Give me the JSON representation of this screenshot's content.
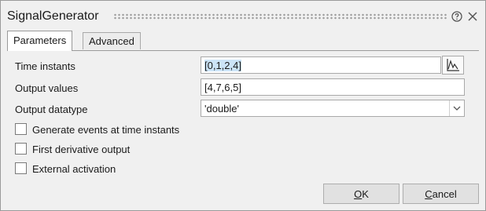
{
  "window": {
    "title": "SignalGenerator",
    "help_icon": "help-circle-icon",
    "close_icon": "close-icon"
  },
  "tabs": [
    {
      "label": "Parameters",
      "active": true
    },
    {
      "label": "Advanced",
      "active": false
    }
  ],
  "parameters": {
    "time_instants": {
      "label": "Time instants",
      "value": "[0,1,2,4]",
      "plot_icon": "plot-icon"
    },
    "output_values": {
      "label": "Output values",
      "value": "[4,7,6,5]"
    },
    "output_datatype": {
      "label": "Output datatype",
      "value": "'double'",
      "arrow_icon": "chevron-down-icon"
    }
  },
  "checkboxes": [
    {
      "label": "Generate events at time instants",
      "checked": false
    },
    {
      "label": "First derivative output",
      "checked": false
    },
    {
      "label": "External activation",
      "checked": false
    }
  ],
  "buttons": {
    "ok": {
      "mnemonic": "O",
      "rest": "K"
    },
    "cancel": {
      "mnemonic": "C",
      "rest": "ancel"
    }
  },
  "colors": {
    "selection": "#cce4f7",
    "dialog_bg": "#f0f0f0"
  }
}
